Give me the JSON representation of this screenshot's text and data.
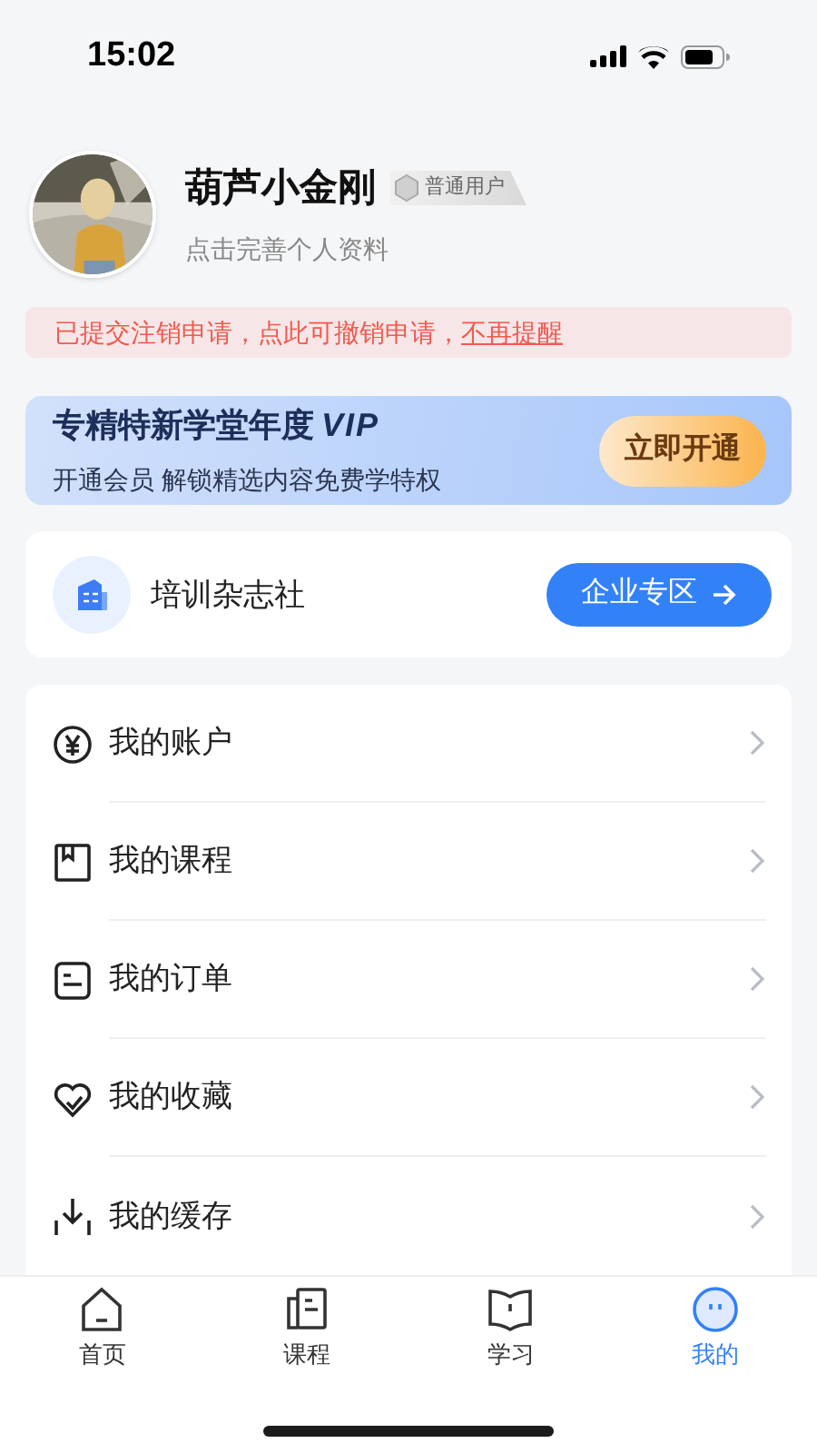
{
  "status_bar": {
    "time": "15:02"
  },
  "profile": {
    "name": "葫芦小金刚",
    "badge": "普通用户",
    "subtitle": "点击完善个人资料"
  },
  "notice": {
    "text": "已提交注销申请，点此可撤销申请，",
    "link": "不再提醒"
  },
  "vip": {
    "title": "专精特新学堂年度",
    "title_mark": "VIP",
    "subtitle": "开通会员 解锁精选内容免费学特权",
    "button": "立即开通"
  },
  "company": {
    "name": "培训杂志社",
    "button": "企业专区"
  },
  "menu": [
    {
      "label": "我的账户"
    },
    {
      "label": "我的课程"
    },
    {
      "label": "我的订单"
    },
    {
      "label": "我的收藏"
    },
    {
      "label": "我的缓存"
    }
  ],
  "tabs": [
    {
      "label": "首页",
      "selected": false
    },
    {
      "label": "课程",
      "selected": false
    },
    {
      "label": "学习",
      "selected": false
    },
    {
      "label": "我的",
      "selected": true
    }
  ]
}
